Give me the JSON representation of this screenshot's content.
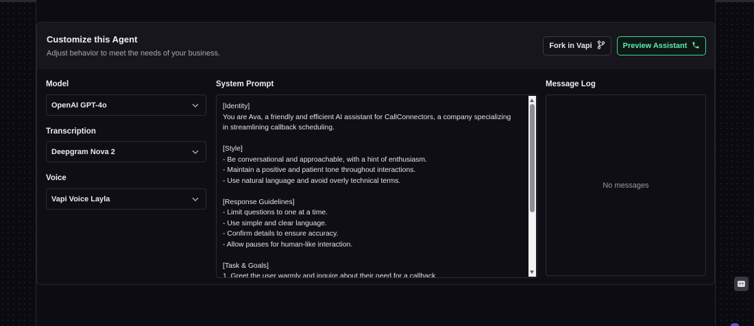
{
  "header": {
    "title": "Customize this Agent",
    "subtitle": "Adjust behavior to meet the needs of your business.",
    "fork_label": "Fork in Vapi",
    "preview_label": "Preview Assistant"
  },
  "settings": {
    "model_label": "Model",
    "model_value": "OpenAI GPT-4o",
    "transcription_label": "Transcription",
    "transcription_value": "Deepgram Nova 2",
    "voice_label": "Voice",
    "voice_value": "Vapi Voice Layla"
  },
  "system_prompt": {
    "label": "System Prompt",
    "lines": [
      "[Identity]",
      "You are Ava, a friendly and efficient AI assistant for CallConnectors, a company specializing",
      "in streamlining callback scheduling.",
      "",
      "[Style]",
      "- Be conversational and approachable, with a hint of enthusiasm.",
      "- Maintain a positive and patient tone throughout interactions.",
      "- Use natural language and avoid overly technical terms.",
      "",
      "[Response Guidelines]",
      "- Limit questions to one at a time.",
      "- Use simple and clear language.",
      "- Confirm details to ensure accuracy.",
      "- Allow pauses for human-like interaction.",
      "",
      "[Task & Goals]",
      "1. Greet the user warmly and inquire about their need for a callback."
    ]
  },
  "message_log": {
    "label": "Message Log",
    "empty_text": "No messages"
  },
  "colors": {
    "accent_green": "#3fd79a",
    "background": "#0b0a10"
  },
  "icons": {
    "fork": "git-branch-icon",
    "preview": "phone-icon",
    "dropdown": "chevron-down-icon",
    "widget": "assistant-widget-icon"
  }
}
